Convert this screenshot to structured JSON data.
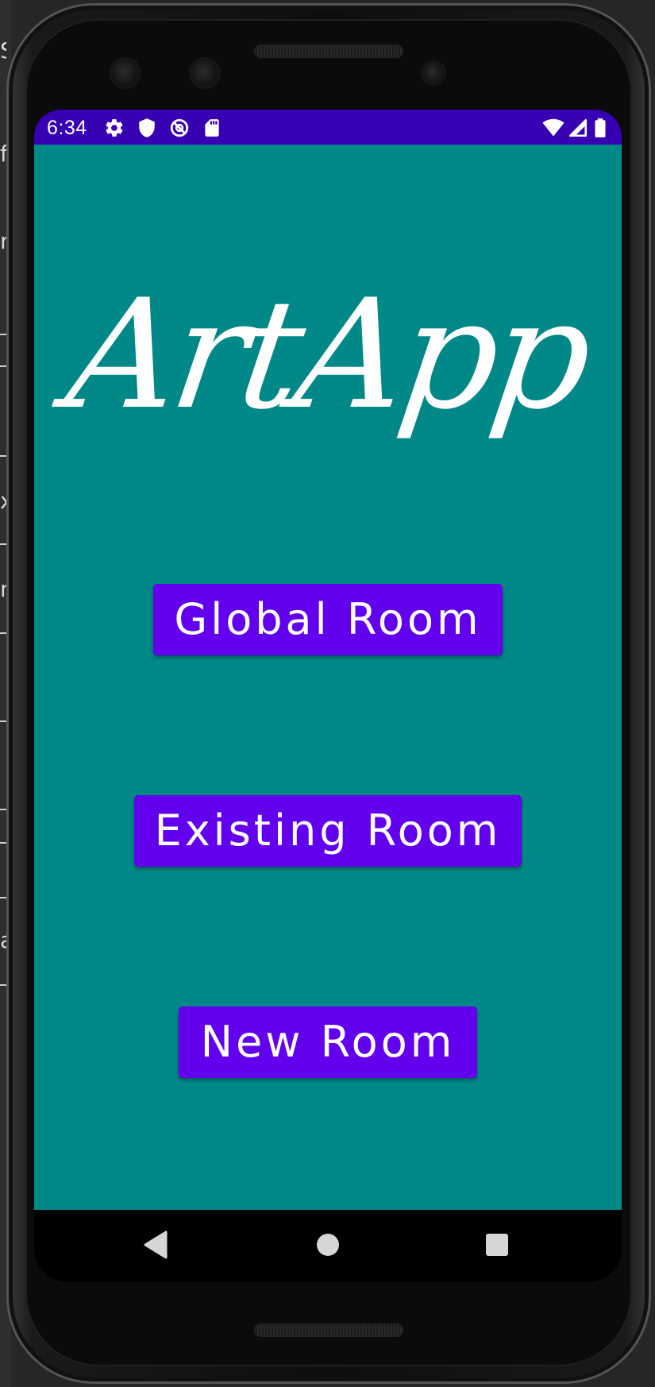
{
  "status_bar": {
    "time": "6:34",
    "left_icons": [
      "gear-icon",
      "shield-icon",
      "no-tracking-icon",
      "sd-card-icon"
    ],
    "right_icons": [
      "wifi-icon",
      "cellular-signal-icon",
      "battery-icon"
    ],
    "color": "#3700b3"
  },
  "app": {
    "logo_text": "ArtApp",
    "background_color": "#008888",
    "buttons": {
      "global_room": "Global Room",
      "existing_room": "Existing Room",
      "new_room": "New Room"
    },
    "button_color": "#6200ee"
  },
  "nav_bar": {
    "back": "back-triangle-icon",
    "home": "home-circle-icon",
    "recents": "recents-square-icon"
  }
}
